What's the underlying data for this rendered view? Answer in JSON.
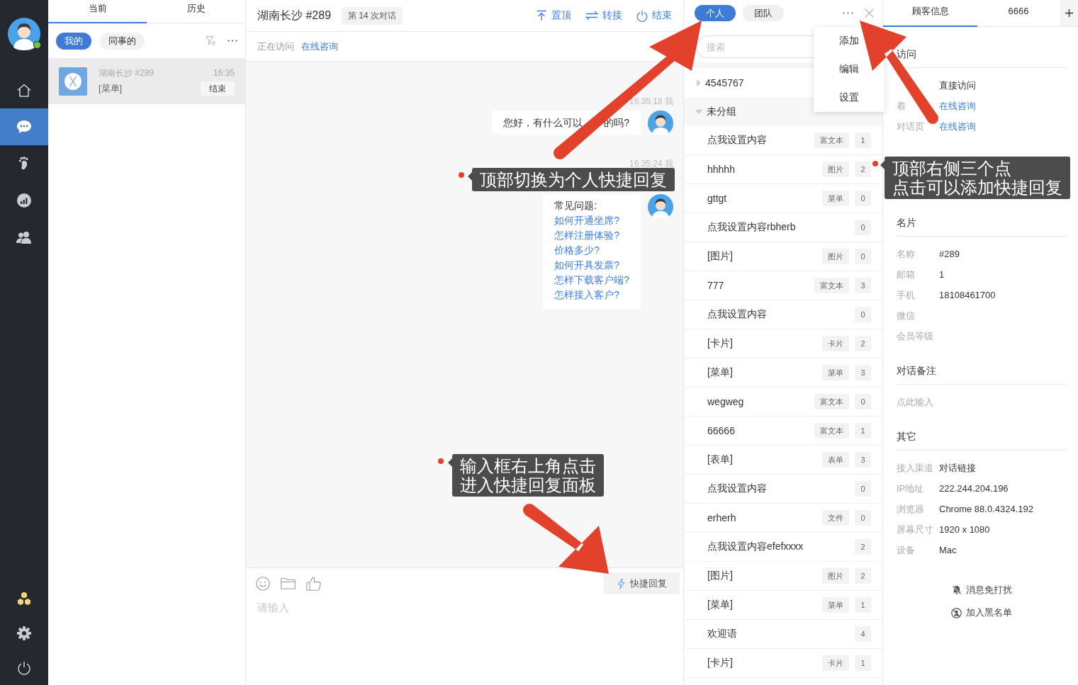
{
  "nav": {
    "user_online": true,
    "items": [
      {
        "selected": false
      },
      {
        "selected": true
      },
      {
        "selected": false
      },
      {
        "selected": false
      },
      {
        "selected": false
      }
    ]
  },
  "conversations": {
    "tabs": [
      {
        "label": "当前",
        "selected": true
      },
      {
        "label": "历史",
        "selected": false
      }
    ],
    "filters": [
      {
        "label": "我的",
        "selected": true
      },
      {
        "label": "同事的",
        "selected": false
      }
    ],
    "items": [
      {
        "title": "湖南长沙 #289",
        "time": "16:35",
        "preview": "[菜单]",
        "action": "结束",
        "selected": true
      }
    ]
  },
  "chat": {
    "title": "湖南长沙 #289",
    "badge": "第 14 次对话",
    "actions": [
      "置顶",
      "转接",
      "结束"
    ],
    "visit": {
      "label": "正在访问",
      "page": "在线咨询"
    },
    "messages": [
      {
        "kind": "text",
        "time": "16:35:18 我",
        "parts": [
          "您好，有什么可以",
          "的吗?"
        ]
      },
      {
        "kind": "menu",
        "time": "16:35:24 我",
        "heading": "常见问题:",
        "links": [
          "如何开通坐席?",
          "怎样注册体验?",
          "价格多少?",
          "如何开具发票?",
          "怎样下载客户端?",
          "怎样接入客户?"
        ]
      }
    ],
    "quick_reply_button": "快捷回复",
    "input": {
      "placeholder": "请输入"
    }
  },
  "quick_replies": {
    "tabs": [
      {
        "label": "个人",
        "selected": true
      },
      {
        "label": "团队",
        "selected": false
      }
    ],
    "search": {
      "placeholder": "搜索"
    },
    "menu": {
      "open": true,
      "items": [
        "添加",
        "编辑",
        "设置"
      ]
    },
    "groups": [
      {
        "name": "4545767",
        "expanded": false
      },
      {
        "name": "未分组",
        "expanded": true,
        "children": [
          {
            "name": "点我设置内容",
            "type": "富文本",
            "count": "1"
          },
          {
            "name": "hhhhh",
            "type": "图片",
            "count": "2"
          },
          {
            "name": "gttgt",
            "type": "菜单",
            "count": "0"
          },
          {
            "name": "点我设置内容rbherb",
            "count": "0"
          },
          {
            "name": "[图片]",
            "type": "图片",
            "count": "0"
          },
          {
            "name": "777",
            "type": "富文本",
            "count": "3"
          },
          {
            "name": "点我设置内容",
            "count": "0"
          },
          {
            "name": "[卡片]",
            "type": "卡片",
            "count": "2"
          },
          {
            "name": "[菜单]",
            "type": "菜单",
            "count": "3"
          },
          {
            "name": "wegweg",
            "type": "富文本",
            "count": "0"
          },
          {
            "name": "66666",
            "type": "富文本",
            "count": "1"
          },
          {
            "name": "[表单]",
            "type": "表单",
            "count": "3"
          },
          {
            "name": "点我设置内容",
            "count": "0"
          },
          {
            "name": "erherh",
            "type": "文件",
            "count": "0"
          },
          {
            "name": "点我设置内容efefxxxx",
            "count": "2"
          },
          {
            "name": "[图片]",
            "type": "图片",
            "count": "2"
          },
          {
            "name": "[菜单]",
            "type": "菜单",
            "count": "1"
          },
          {
            "name": "欢迎语",
            "count": "4"
          },
          {
            "name": "[卡片]",
            "type": "卡片",
            "count": "1"
          }
        ]
      }
    ]
  },
  "customer": {
    "tabs": [
      {
        "label": "顾客信息",
        "selected": true
      },
      {
        "label": "6666",
        "selected": false
      }
    ],
    "sections": [
      {
        "title": "访问",
        "rows": [
          {
            "value": "直接访问",
            "link": false
          },
          {
            "label": "着",
            "value": "在线咨询",
            "link": true
          },
          {
            "label": "对话页",
            "value": "在线咨询",
            "link": true
          }
        ]
      },
      {
        "title": "名片",
        "rows": [
          {
            "label": "名称",
            "value": "#289",
            "link": false
          },
          {
            "label": "邮箱",
            "value": "1",
            "link": false
          },
          {
            "label": "手机",
            "value": "18108461700",
            "link": false
          },
          {
            "label": "微信"
          },
          {
            "label": "会员等级"
          }
        ]
      },
      {
        "title": "对话备注",
        "placeholder": "点此输入"
      },
      {
        "title": "其它",
        "rows": [
          {
            "label": "接入渠道",
            "value": "对话链接",
            "link": false
          },
          {
            "label": "IP地址",
            "value": "222.244.204.196",
            "link": false
          },
          {
            "label": "浏览器",
            "value": "Chrome 88.0.4324.192",
            "link": false
          },
          {
            "label": "屏幕尺寸",
            "value": "1920 x 1080",
            "link": false
          },
          {
            "label": "设备",
            "value": "Mac",
            "link": false
          }
        ]
      }
    ],
    "actions": [
      "消息免打扰",
      "加入黑名单"
    ]
  },
  "annotations": [
    {
      "lines": [
        "顶部切换为个人快捷回复"
      ]
    },
    {
      "lines": [
        "顶部右侧三个点",
        "点击可以添加快捷回复"
      ]
    },
    {
      "lines": [
        "输入框右上角点击",
        "进入快捷回复面板"
      ]
    }
  ]
}
